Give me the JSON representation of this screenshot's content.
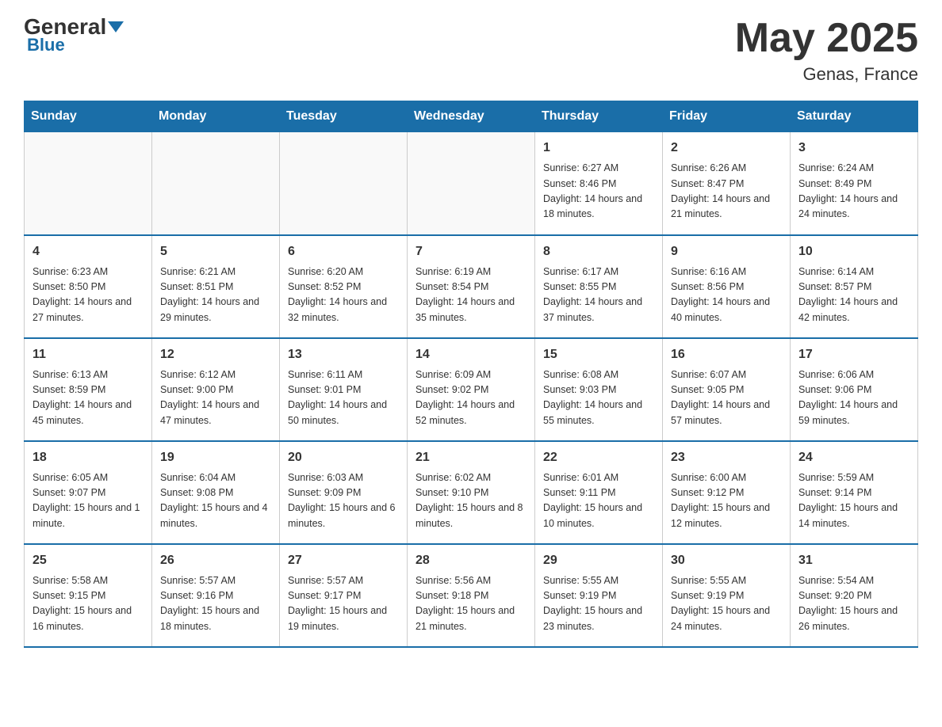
{
  "header": {
    "logo_general": "General",
    "logo_blue": "Blue",
    "title": "May 2025",
    "subtitle": "Genas, France"
  },
  "calendar": {
    "days_of_week": [
      "Sunday",
      "Monday",
      "Tuesday",
      "Wednesday",
      "Thursday",
      "Friday",
      "Saturday"
    ],
    "weeks": [
      [
        {
          "day": "",
          "info": ""
        },
        {
          "day": "",
          "info": ""
        },
        {
          "day": "",
          "info": ""
        },
        {
          "day": "",
          "info": ""
        },
        {
          "day": "1",
          "info": "Sunrise: 6:27 AM\nSunset: 8:46 PM\nDaylight: 14 hours and 18 minutes."
        },
        {
          "day": "2",
          "info": "Sunrise: 6:26 AM\nSunset: 8:47 PM\nDaylight: 14 hours and 21 minutes."
        },
        {
          "day": "3",
          "info": "Sunrise: 6:24 AM\nSunset: 8:49 PM\nDaylight: 14 hours and 24 minutes."
        }
      ],
      [
        {
          "day": "4",
          "info": "Sunrise: 6:23 AM\nSunset: 8:50 PM\nDaylight: 14 hours and 27 minutes."
        },
        {
          "day": "5",
          "info": "Sunrise: 6:21 AM\nSunset: 8:51 PM\nDaylight: 14 hours and 29 minutes."
        },
        {
          "day": "6",
          "info": "Sunrise: 6:20 AM\nSunset: 8:52 PM\nDaylight: 14 hours and 32 minutes."
        },
        {
          "day": "7",
          "info": "Sunrise: 6:19 AM\nSunset: 8:54 PM\nDaylight: 14 hours and 35 minutes."
        },
        {
          "day": "8",
          "info": "Sunrise: 6:17 AM\nSunset: 8:55 PM\nDaylight: 14 hours and 37 minutes."
        },
        {
          "day": "9",
          "info": "Sunrise: 6:16 AM\nSunset: 8:56 PM\nDaylight: 14 hours and 40 minutes."
        },
        {
          "day": "10",
          "info": "Sunrise: 6:14 AM\nSunset: 8:57 PM\nDaylight: 14 hours and 42 minutes."
        }
      ],
      [
        {
          "day": "11",
          "info": "Sunrise: 6:13 AM\nSunset: 8:59 PM\nDaylight: 14 hours and 45 minutes."
        },
        {
          "day": "12",
          "info": "Sunrise: 6:12 AM\nSunset: 9:00 PM\nDaylight: 14 hours and 47 minutes."
        },
        {
          "day": "13",
          "info": "Sunrise: 6:11 AM\nSunset: 9:01 PM\nDaylight: 14 hours and 50 minutes."
        },
        {
          "day": "14",
          "info": "Sunrise: 6:09 AM\nSunset: 9:02 PM\nDaylight: 14 hours and 52 minutes."
        },
        {
          "day": "15",
          "info": "Sunrise: 6:08 AM\nSunset: 9:03 PM\nDaylight: 14 hours and 55 minutes."
        },
        {
          "day": "16",
          "info": "Sunrise: 6:07 AM\nSunset: 9:05 PM\nDaylight: 14 hours and 57 minutes."
        },
        {
          "day": "17",
          "info": "Sunrise: 6:06 AM\nSunset: 9:06 PM\nDaylight: 14 hours and 59 minutes."
        }
      ],
      [
        {
          "day": "18",
          "info": "Sunrise: 6:05 AM\nSunset: 9:07 PM\nDaylight: 15 hours and 1 minute."
        },
        {
          "day": "19",
          "info": "Sunrise: 6:04 AM\nSunset: 9:08 PM\nDaylight: 15 hours and 4 minutes."
        },
        {
          "day": "20",
          "info": "Sunrise: 6:03 AM\nSunset: 9:09 PM\nDaylight: 15 hours and 6 minutes."
        },
        {
          "day": "21",
          "info": "Sunrise: 6:02 AM\nSunset: 9:10 PM\nDaylight: 15 hours and 8 minutes."
        },
        {
          "day": "22",
          "info": "Sunrise: 6:01 AM\nSunset: 9:11 PM\nDaylight: 15 hours and 10 minutes."
        },
        {
          "day": "23",
          "info": "Sunrise: 6:00 AM\nSunset: 9:12 PM\nDaylight: 15 hours and 12 minutes."
        },
        {
          "day": "24",
          "info": "Sunrise: 5:59 AM\nSunset: 9:14 PM\nDaylight: 15 hours and 14 minutes."
        }
      ],
      [
        {
          "day": "25",
          "info": "Sunrise: 5:58 AM\nSunset: 9:15 PM\nDaylight: 15 hours and 16 minutes."
        },
        {
          "day": "26",
          "info": "Sunrise: 5:57 AM\nSunset: 9:16 PM\nDaylight: 15 hours and 18 minutes."
        },
        {
          "day": "27",
          "info": "Sunrise: 5:57 AM\nSunset: 9:17 PM\nDaylight: 15 hours and 19 minutes."
        },
        {
          "day": "28",
          "info": "Sunrise: 5:56 AM\nSunset: 9:18 PM\nDaylight: 15 hours and 21 minutes."
        },
        {
          "day": "29",
          "info": "Sunrise: 5:55 AM\nSunset: 9:19 PM\nDaylight: 15 hours and 23 minutes."
        },
        {
          "day": "30",
          "info": "Sunrise: 5:55 AM\nSunset: 9:19 PM\nDaylight: 15 hours and 24 minutes."
        },
        {
          "day": "31",
          "info": "Sunrise: 5:54 AM\nSunset: 9:20 PM\nDaylight: 15 hours and 26 minutes."
        }
      ]
    ]
  }
}
